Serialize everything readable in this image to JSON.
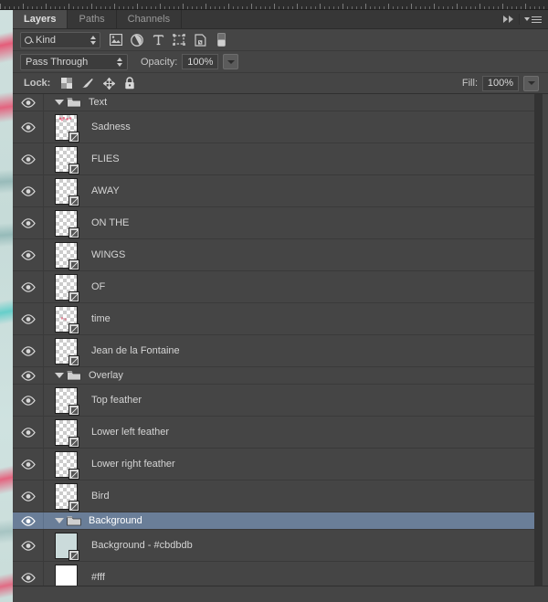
{
  "app": {
    "panel_title": "Layers"
  },
  "ruler": {
    "name": "horizontal-ruler"
  },
  "tabs": [
    {
      "label": "Layers",
      "active": true
    },
    {
      "label": "Paths",
      "active": false
    },
    {
      "label": "Channels",
      "active": false
    }
  ],
  "tabbar": {
    "collapse_icon": "double-arrow-icon",
    "menu_icon": "panel-menu-icon"
  },
  "filter": {
    "kind_label": "Kind",
    "search_icon": "search-icon",
    "icons": [
      {
        "name": "filter-pixel-layers-icon",
        "title": "Pixel layers"
      },
      {
        "name": "filter-adjustment-layers-icon",
        "title": "Adjustment layers"
      },
      {
        "name": "filter-type-layers-icon",
        "title": "Type layers"
      },
      {
        "name": "filter-shape-layers-icon",
        "title": "Shape layers"
      },
      {
        "name": "filter-smart-objects-icon",
        "title": "Smart objects"
      },
      {
        "name": "filter-toggle-icon",
        "title": "Turn filtering on/off"
      }
    ]
  },
  "blend": {
    "mode": "Pass Through",
    "opacity_label": "Opacity:",
    "opacity_value": "100%",
    "fill_label": "Fill:",
    "fill_value": "100%"
  },
  "lock": {
    "label": "Lock:",
    "icons": [
      {
        "name": "lock-transparent-pixels-icon"
      },
      {
        "name": "lock-image-pixels-icon"
      },
      {
        "name": "lock-position-icon"
      },
      {
        "name": "lock-all-icon"
      }
    ]
  },
  "layers": [
    {
      "name": "Text",
      "type": "group",
      "expanded": true,
      "visible": true,
      "selected": false
    },
    {
      "name": "Sadness",
      "type": "smart",
      "visible": true,
      "selected": false,
      "art": "pink"
    },
    {
      "name": "FLIES",
      "type": "smart",
      "visible": true,
      "selected": false,
      "art": ""
    },
    {
      "name": "AWAY",
      "type": "smart",
      "visible": true,
      "selected": false,
      "art": ""
    },
    {
      "name": "ON THE",
      "type": "smart",
      "visible": true,
      "selected": false,
      "art": ""
    },
    {
      "name": "WINGS",
      "type": "smart",
      "visible": true,
      "selected": false,
      "art": ""
    },
    {
      "name": "OF",
      "type": "smart",
      "visible": true,
      "selected": false,
      "art": ""
    },
    {
      "name": "time",
      "type": "smart",
      "visible": true,
      "selected": false,
      "art": "pink-s"
    },
    {
      "name": "Jean de la Fontaine",
      "type": "smart",
      "visible": true,
      "selected": false,
      "art": ""
    },
    {
      "name": "Overlay",
      "type": "group",
      "expanded": true,
      "visible": true,
      "selected": false
    },
    {
      "name": "Top feather",
      "type": "smart",
      "visible": true,
      "selected": false,
      "art": ""
    },
    {
      "name": "Lower left feather",
      "type": "smart",
      "visible": true,
      "selected": false,
      "art": ""
    },
    {
      "name": "Lower right feather",
      "type": "smart",
      "visible": true,
      "selected": false,
      "art": ""
    },
    {
      "name": "Bird",
      "type": "smart",
      "visible": true,
      "selected": false,
      "art": ""
    },
    {
      "name": "Background",
      "type": "group",
      "expanded": true,
      "visible": true,
      "selected": true
    },
    {
      "name": "Background - #cbdbdb",
      "type": "smart-solid",
      "visible": true,
      "selected": false,
      "fill": "#cbdbdb"
    },
    {
      "name": "#fff",
      "type": "solid",
      "visible": true,
      "selected": false,
      "fill": "#ffffff"
    }
  ],
  "colors": {
    "panel_bg": "#454545",
    "row_divider": "#3a3a3a",
    "selection": "#6a7e98",
    "tab_active_bg": "#4b4b4b",
    "text": "#d4d4d4"
  },
  "scrollbar": {
    "name": "layers-vertical-scrollbar"
  }
}
